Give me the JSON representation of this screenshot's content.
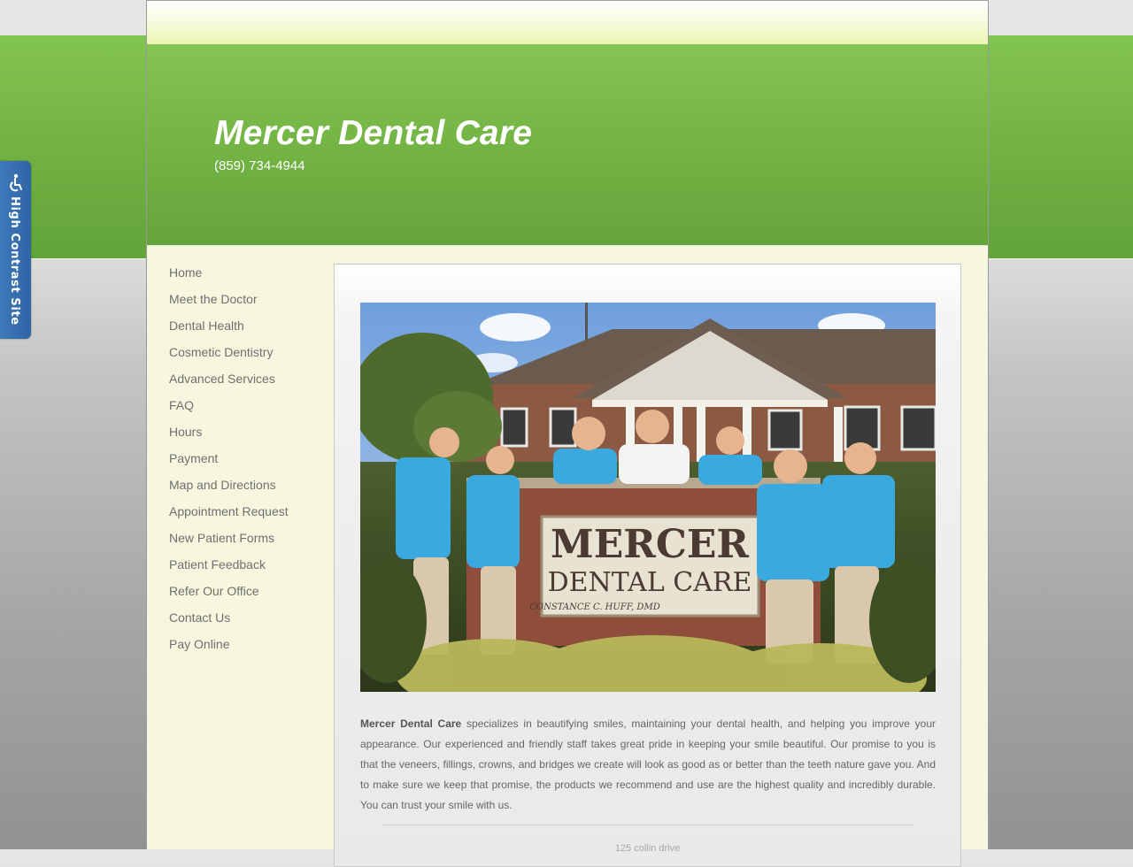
{
  "header": {
    "title": "Mercer Dental Care",
    "phone": "(859) 734-4944"
  },
  "nav": {
    "items": [
      "Home",
      "Meet the Doctor",
      "Dental Health",
      "Cosmetic Dentistry",
      "Advanced Services",
      "FAQ",
      "Hours",
      "Payment",
      "Map and Directions",
      "Appointment Request",
      "New Patient Forms",
      "Patient Feedback",
      "Refer Our Office",
      "Contact Us",
      "Pay Online"
    ]
  },
  "photo": {
    "sign_line1": "MERCER",
    "sign_line2": "DENTAL CARE",
    "sign_line3": "CONSTANCE C. HUFF, DMD"
  },
  "intro": {
    "lead": "Mercer Dental Care",
    "body": " specializes in beautifying smiles, maintaining your dental health, and helping you improve your appearance. Our experienced and friendly staff takes great pride in keeping your smile beautiful. Our promise to you is that the veneers, fillings, crowns, and bridges we create will look as good as or better than the teeth nature gave you. And to make sure we keep that promise, the products we recommend and use are the highest quality and incredibly durable. You can trust your smile with us."
  },
  "footer": {
    "address": "125 collin drive"
  },
  "accessibility": {
    "label": "High Contrast Site",
    "icon": "wheelchair-icon"
  },
  "colors": {
    "header_green": "#76b646",
    "page_background": "#f7f7e0",
    "tab_blue": "#3f79b8",
    "nav_text": "#6f6f6f"
  }
}
